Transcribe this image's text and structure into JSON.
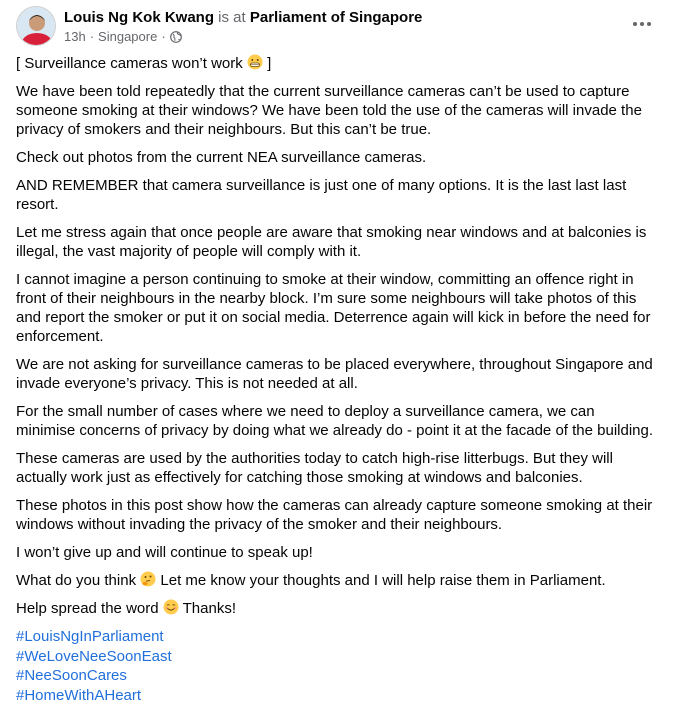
{
  "post": {
    "author": "Louis Ng Kok Kwang",
    "is_at": "is at",
    "location": "Parliament of Singapore",
    "time": "13h",
    "place": "Singapore",
    "separator": "·",
    "more_icon": "more-dots-icon",
    "privacy_icon": "globe-icon"
  },
  "body": {
    "p1_text": "[ Surveillance cameras won’t work ",
    "p1_end": " ]",
    "p2": "We have been told repeatedly that the current surveillance cameras can’t be used to capture someone smoking at their windows? We have been told the use of the cameras will invade the privacy of smokers and their neighbours. But this can’t be true.",
    "p3": "Check out photos from the current NEA surveillance cameras.",
    "p4": "AND REMEMBER that camera surveillance is just one of many options. It is the last last last resort.",
    "p5": "Let me stress again that once people are aware that smoking near windows and at balconies is illegal, the vast majority of people will comply with it.",
    "p6": "I cannot imagine a person continuing to smoke at their window, committing an offence right in front of their neighbours in the nearby block. I’m sure some neighbours will take photos of this and report the smoker or put it on social media. Deterrence again will kick in before the need for enforcement.",
    "p7": "We are not asking for surveillance cameras to be placed everywhere, throughout Singapore and invade everyone’s privacy. This is not needed at all.",
    "p8": "For the small number of cases where we need to deploy a surveillance camera, we can minimise concerns of privacy by doing what we already do - point it at the facade of the building.",
    "p9": "These cameras are used by the authorities today to catch high-rise litterbugs. But they will actually work just as effectively for catching those smoking at windows and balconies.",
    "p10": "These photos in this post show how the cameras can already capture someone smoking at their windows without invading the privacy of the smoker and their neighbours.",
    "p11": "I won’t give up and will continue to speak up!",
    "p12_a": "What do you think ",
    "p12_b": " Let me know your thoughts and I will help raise them in Parliament.",
    "p13_a": "Help spread the word ",
    "p13_b": " Thanks!",
    "emojis": [
      "grimacing-face-emoji",
      "thinking-face-emoji",
      "smiling-face-emoji"
    ]
  },
  "hashtags": [
    "#LouisNgInParliament",
    "#WeLoveNeeSoonEast",
    "#NeeSoonCares",
    "#HomeWithAHeart"
  ],
  "colors": {
    "text": "#050505",
    "secondary": "#65676b",
    "link": "#216fdb"
  }
}
